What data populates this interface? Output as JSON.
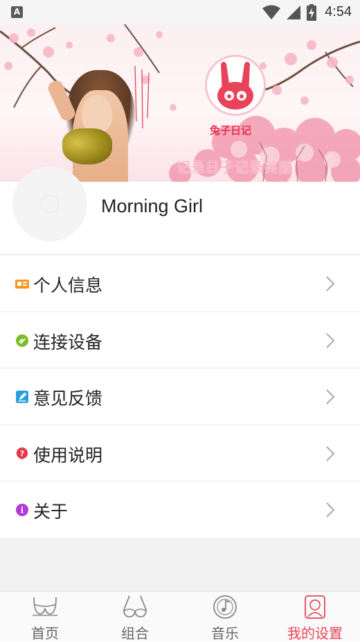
{
  "status_bar": {
    "app_icon_letter": "A",
    "time": "4:54"
  },
  "banner": {
    "logo_text": "兔子日记",
    "slogan": "记录日子记录美丽"
  },
  "profile": {
    "username": "Morning Girl"
  },
  "menu": {
    "items": [
      {
        "label": "个人信息",
        "icon": "id-card-icon",
        "color": "#f39a1e"
      },
      {
        "label": "连接设备",
        "icon": "link-icon",
        "color": "#7cbc2a"
      },
      {
        "label": "意见反馈",
        "icon": "edit-icon",
        "color": "#2a9fe0"
      },
      {
        "label": "使用说明",
        "icon": "question-icon",
        "color": "#e53a4a"
      },
      {
        "label": "关于",
        "icon": "info-icon",
        "color": "#b43ad6"
      }
    ]
  },
  "bottom_nav": {
    "items": [
      {
        "label": "首页",
        "icon": "bra-outline-icon",
        "active": false
      },
      {
        "label": "组合",
        "icon": "bra-combo-icon",
        "active": false
      },
      {
        "label": "音乐",
        "icon": "music-disc-icon",
        "active": false
      },
      {
        "label": "我的设置",
        "icon": "user-settings-icon",
        "active": true
      }
    ],
    "active_color": "#e7435a",
    "inactive_color": "#666666"
  }
}
